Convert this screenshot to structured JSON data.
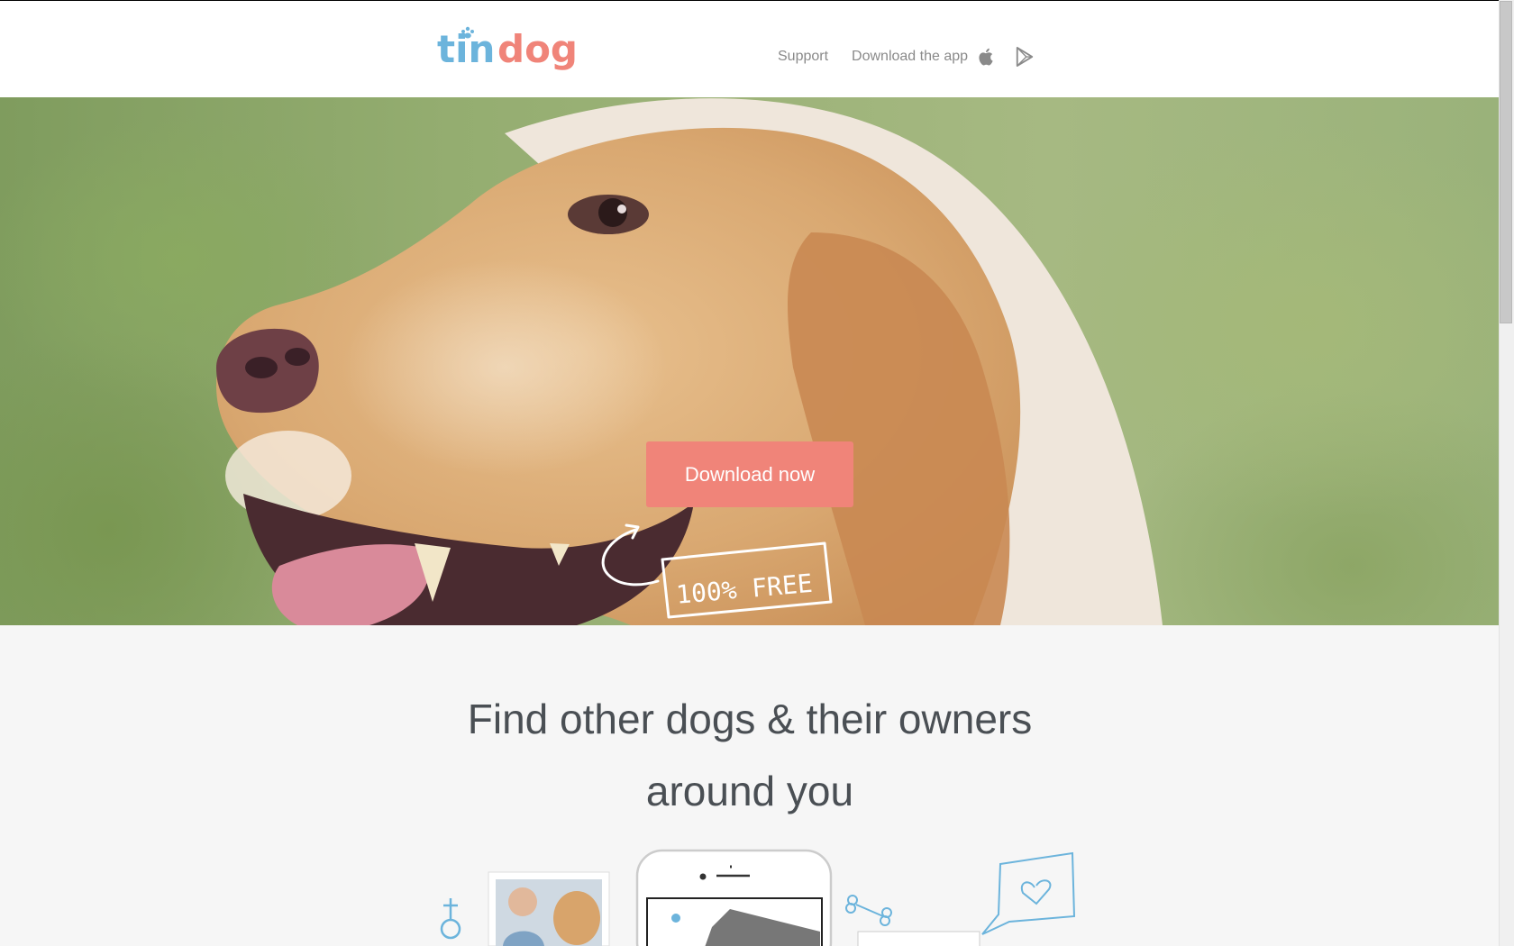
{
  "brand": {
    "logo_text_blue": "tin",
    "logo_text_red": "dog",
    "colors": {
      "blue": "#6cb4dc",
      "red": "#f08479",
      "text": "#4a4f54",
      "nav": "#8a8a8a"
    }
  },
  "nav": {
    "support": "Support",
    "download_app": "Download the app",
    "icons": [
      "apple-icon",
      "google-play-icon"
    ]
  },
  "hero": {
    "cta_label": "Download now",
    "badge_text": "100% FREE"
  },
  "features": {
    "headline_line1": "Find other dogs & their owners",
    "headline_line2": "around you"
  }
}
